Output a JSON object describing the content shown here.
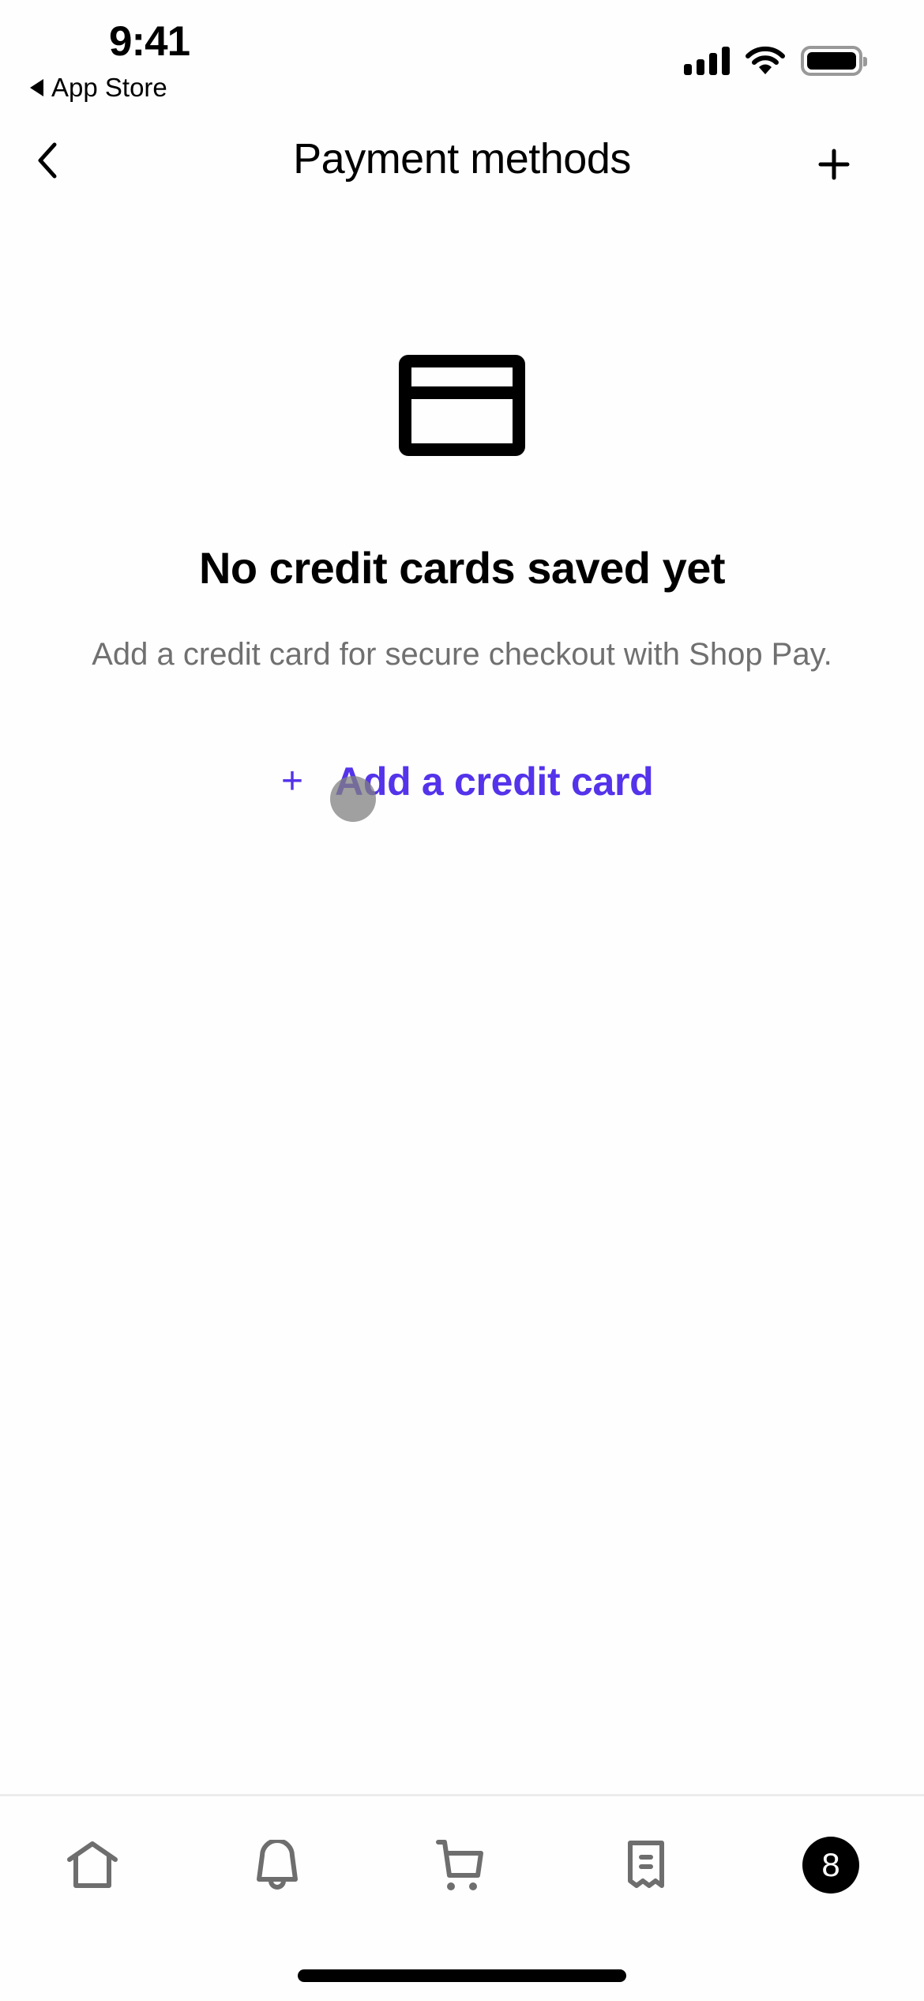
{
  "status_bar": {
    "time": "9:41",
    "back_app": "App Store",
    "icons": [
      "cellular-signal-icon",
      "wifi-icon",
      "battery-icon"
    ]
  },
  "nav": {
    "title": "Payment methods",
    "back_icon": "chevron-left-icon",
    "add_icon": "plus-icon"
  },
  "empty_state": {
    "icon": "credit-card-icon",
    "title": "No credit cards saved yet",
    "subtitle": "Add a credit card for secure checkout with Shop Pay.",
    "action": {
      "icon": "plus-icon",
      "plus_glyph": "+",
      "label": "Add a credit card"
    }
  },
  "tab_bar": {
    "tabs": [
      {
        "name": "home",
        "icon": "home-icon"
      },
      {
        "name": "notifications",
        "icon": "bell-icon"
      },
      {
        "name": "cart",
        "icon": "cart-icon"
      },
      {
        "name": "orders",
        "icon": "receipt-icon"
      },
      {
        "name": "account",
        "icon": "avatar",
        "avatar_text": "8"
      }
    ]
  },
  "colors": {
    "accent": "#5433eb",
    "text_primary": "#000000",
    "text_secondary": "#707070",
    "tab_icon": "#6e6e6e",
    "background": "#fefefe"
  }
}
